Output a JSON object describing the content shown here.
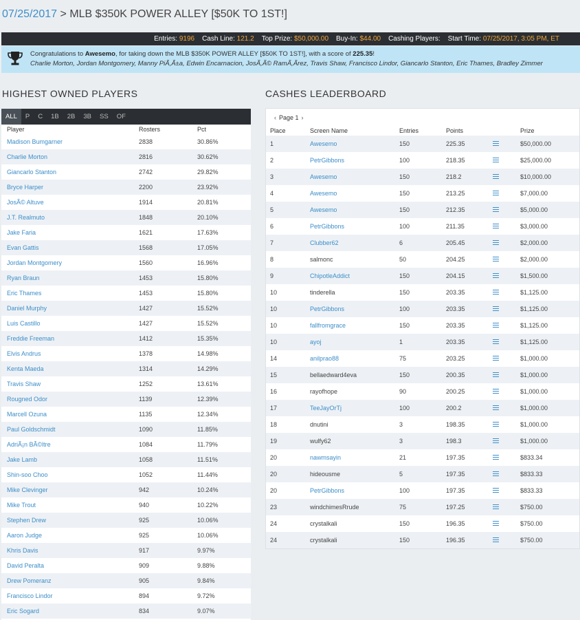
{
  "header": {
    "date": "07/25/2017",
    "separator": ">",
    "contest_name": "MLB $350K POWER ALLEY [$50K TO 1ST!]"
  },
  "stats": [
    {
      "label": "Entries:",
      "value": "9196"
    },
    {
      "label": "Cash Line:",
      "value": "121.2"
    },
    {
      "label": "Top Prize:",
      "value": "$50,000.00"
    },
    {
      "label": "Buy-In:",
      "value": "$44.00"
    },
    {
      "label": "Cashing Players:",
      "value": ""
    },
    {
      "label": "Start Time:",
      "value": "07/25/2017, 3:05 PM, ET"
    }
  ],
  "congrats": {
    "prefix": "Congratulations to ",
    "winner": "Awesemo",
    "middle": ", for taking down the MLB $350K POWER ALLEY [$50K TO 1ST!], with a score of ",
    "score": "225.35",
    "suffix": "!",
    "lineup": "Charlie Morton, Jordan Montgomery, Manny PiÃ,Ã±a, Edwin Encarnacion, JosÃ,Ã© RamÃ,Ã­rez, Travis Shaw, Francisco Lindor, Giancarlo Stanton, Eric Thames, Bradley Zimmer"
  },
  "owned": {
    "title": "HIGHEST OWNED PLAYERS",
    "tabs": [
      "ALL",
      "P",
      "C",
      "1B",
      "2B",
      "3B",
      "SS",
      "OF"
    ],
    "columns": [
      "Player",
      "Rosters",
      "Pct"
    ],
    "rows": [
      {
        "player": "Madison Bumgarner",
        "rosters": "2838",
        "pct": "30.86%"
      },
      {
        "player": "Charlie Morton",
        "rosters": "2816",
        "pct": "30.62%"
      },
      {
        "player": "Giancarlo Stanton",
        "rosters": "2742",
        "pct": "29.82%"
      },
      {
        "player": "Bryce Harper",
        "rosters": "2200",
        "pct": "23.92%"
      },
      {
        "player": "JosÃ© Altuve",
        "rosters": "1914",
        "pct": "20.81%"
      },
      {
        "player": "J.T. Realmuto",
        "rosters": "1848",
        "pct": "20.10%"
      },
      {
        "player": "Jake Faria",
        "rosters": "1621",
        "pct": "17.63%"
      },
      {
        "player": "Evan Gattis",
        "rosters": "1568",
        "pct": "17.05%"
      },
      {
        "player": "Jordan Montgomery",
        "rosters": "1560",
        "pct": "16.96%"
      },
      {
        "player": "Ryan Braun",
        "rosters": "1453",
        "pct": "15.80%"
      },
      {
        "player": "Eric Thames",
        "rosters": "1453",
        "pct": "15.80%"
      },
      {
        "player": "Daniel Murphy",
        "rosters": "1427",
        "pct": "15.52%"
      },
      {
        "player": "Luis Castillo",
        "rosters": "1427",
        "pct": "15.52%"
      },
      {
        "player": "Freddie Freeman",
        "rosters": "1412",
        "pct": "15.35%"
      },
      {
        "player": "Elvis Andrus",
        "rosters": "1378",
        "pct": "14.98%"
      },
      {
        "player": "Kenta Maeda",
        "rosters": "1314",
        "pct": "14.29%"
      },
      {
        "player": "Travis Shaw",
        "rosters": "1252",
        "pct": "13.61%"
      },
      {
        "player": "Rougned Odor",
        "rosters": "1139",
        "pct": "12.39%"
      },
      {
        "player": "Marcell Ozuna",
        "rosters": "1135",
        "pct": "12.34%"
      },
      {
        "player": "Paul Goldschmidt",
        "rosters": "1090",
        "pct": "11.85%"
      },
      {
        "player": "AdriÃ¡n BÃ©ltre",
        "rosters": "1084",
        "pct": "11.79%"
      },
      {
        "player": "Jake Lamb",
        "rosters": "1058",
        "pct": "11.51%"
      },
      {
        "player": "Shin-soo Choo",
        "rosters": "1052",
        "pct": "11.44%"
      },
      {
        "player": "Mike Clevinger",
        "rosters": "942",
        "pct": "10.24%"
      },
      {
        "player": "Mike Trout",
        "rosters": "940",
        "pct": "10.22%"
      },
      {
        "player": "Stephen Drew",
        "rosters": "925",
        "pct": "10.06%"
      },
      {
        "player": "Aaron Judge",
        "rosters": "925",
        "pct": "10.06%"
      },
      {
        "player": "Khris Davis",
        "rosters": "917",
        "pct": "9.97%"
      },
      {
        "player": "David Peralta",
        "rosters": "909",
        "pct": "9.88%"
      },
      {
        "player": "Drew Pomeranz",
        "rosters": "905",
        "pct": "9.84%"
      },
      {
        "player": "Francisco Lindor",
        "rosters": "894",
        "pct": "9.72%"
      },
      {
        "player": "Eric Sogard",
        "rosters": "834",
        "pct": "9.07%"
      }
    ]
  },
  "leaderboard": {
    "title": "CASHES LEADERBOARD",
    "page_label": "Page 1",
    "prev_arrow": "‹",
    "next_arrow": "›",
    "columns": [
      "Place",
      "Screen Name",
      "Entries",
      "Points",
      "",
      "Prize"
    ],
    "rows": [
      {
        "place": "1",
        "name": "Awesemo",
        "link": true,
        "entries": "150",
        "points": "225.35",
        "prize": "$50,000.00"
      },
      {
        "place": "2",
        "name": "PetrGibbons",
        "link": true,
        "entries": "100",
        "points": "218.35",
        "prize": "$25,000.00"
      },
      {
        "place": "3",
        "name": "Awesemo",
        "link": true,
        "entries": "150",
        "points": "218.2",
        "prize": "$10,000.00"
      },
      {
        "place": "4",
        "name": "Awesemo",
        "link": true,
        "entries": "150",
        "points": "213.25",
        "prize": "$7,000.00"
      },
      {
        "place": "5",
        "name": "Awesemo",
        "link": true,
        "entries": "150",
        "points": "212.35",
        "prize": "$5,000.00"
      },
      {
        "place": "6",
        "name": "PetrGibbons",
        "link": true,
        "entries": "100",
        "points": "211.35",
        "prize": "$3,000.00"
      },
      {
        "place": "7",
        "name": "Clubber62",
        "link": true,
        "entries": "6",
        "points": "205.45",
        "prize": "$2,000.00"
      },
      {
        "place": "8",
        "name": "salmonc",
        "link": false,
        "entries": "50",
        "points": "204.25",
        "prize": "$2,000.00"
      },
      {
        "place": "9",
        "name": "ChipotleAddict",
        "link": true,
        "entries": "150",
        "points": "204.15",
        "prize": "$1,500.00"
      },
      {
        "place": "10",
        "name": "tinderella",
        "link": false,
        "entries": "150",
        "points": "203.35",
        "prize": "$1,125.00"
      },
      {
        "place": "10",
        "name": "PetrGibbons",
        "link": true,
        "entries": "100",
        "points": "203.35",
        "prize": "$1,125.00"
      },
      {
        "place": "10",
        "name": "fallfromgrace",
        "link": true,
        "entries": "150",
        "points": "203.35",
        "prize": "$1,125.00"
      },
      {
        "place": "10",
        "name": "ayoj",
        "link": true,
        "entries": "1",
        "points": "203.35",
        "prize": "$1,125.00"
      },
      {
        "place": "14",
        "name": "anilprao88",
        "link": true,
        "entries": "75",
        "points": "203.25",
        "prize": "$1,000.00"
      },
      {
        "place": "15",
        "name": "bellaedward4eva",
        "link": false,
        "entries": "150",
        "points": "200.35",
        "prize": "$1,000.00"
      },
      {
        "place": "16",
        "name": "rayofhope",
        "link": false,
        "entries": "90",
        "points": "200.25",
        "prize": "$1,000.00"
      },
      {
        "place": "17",
        "name": "TeeJayOrTj",
        "link": true,
        "entries": "100",
        "points": "200.2",
        "prize": "$1,000.00"
      },
      {
        "place": "18",
        "name": "dnutini",
        "link": false,
        "entries": "3",
        "points": "198.35",
        "prize": "$1,000.00"
      },
      {
        "place": "19",
        "name": "wulfy62",
        "link": false,
        "entries": "3",
        "points": "198.3",
        "prize": "$1,000.00"
      },
      {
        "place": "20",
        "name": "nawmsayin",
        "link": true,
        "entries": "21",
        "points": "197.35",
        "prize": "$833.34"
      },
      {
        "place": "20",
        "name": "hideousme",
        "link": false,
        "entries": "5",
        "points": "197.35",
        "prize": "$833.33"
      },
      {
        "place": "20",
        "name": "PetrGibbons",
        "link": true,
        "entries": "100",
        "points": "197.35",
        "prize": "$833.33"
      },
      {
        "place": "23",
        "name": "windchimesRrude",
        "link": false,
        "entries": "75",
        "points": "197.25",
        "prize": "$750.00"
      },
      {
        "place": "24",
        "name": "crystalkali",
        "link": false,
        "entries": "150",
        "points": "196.35",
        "prize": "$750.00"
      },
      {
        "place": "24",
        "name": "crystalkali",
        "link": false,
        "entries": "150",
        "points": "196.35",
        "prize": "$750.00"
      }
    ]
  }
}
